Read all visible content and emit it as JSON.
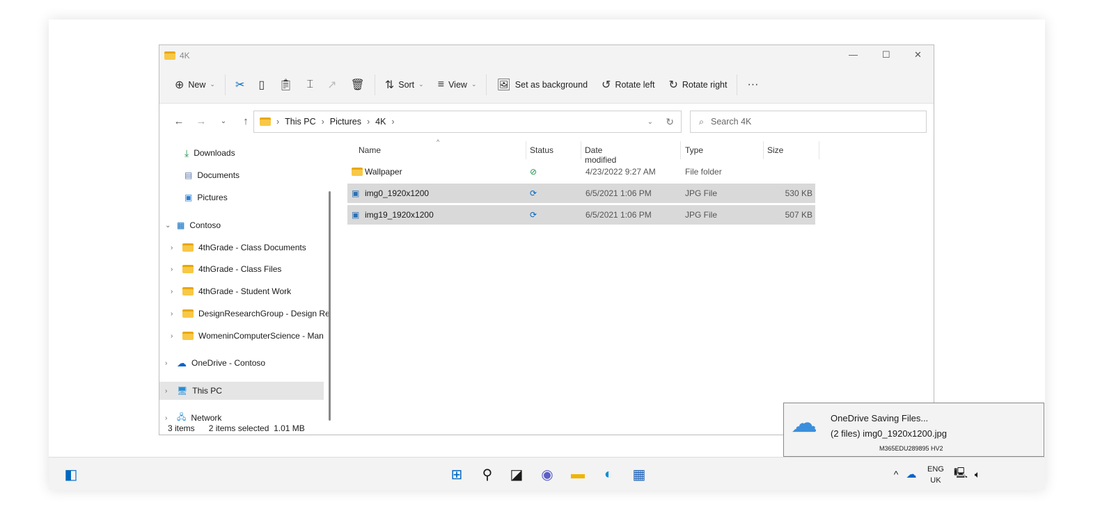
{
  "window": {
    "title": "4K"
  },
  "toolbar": {
    "new": "New",
    "sort": "Sort",
    "view": "View",
    "set_bg": "Set as background",
    "rotate_left": "Rotate left",
    "rotate_right": "Rotate right"
  },
  "address": {
    "crumbs": [
      "This PC",
      "Pictures",
      "4K"
    ]
  },
  "search": {
    "placeholder": "Search 4K"
  },
  "sidebar": {
    "items": [
      "Downloads",
      "Documents",
      "Pictures",
      "Contoso",
      "4thGrade - Class Documents",
      "4thGrade - Class Files",
      "4thGrade - Student Work",
      "DesignResearchGroup - Design Re",
      "WomeninComputerScience - Man",
      "OneDrive - Contoso",
      "This PC",
      "Network"
    ]
  },
  "columns": [
    "Name",
    "Status",
    "Date modified",
    "Type",
    "Size"
  ],
  "files": [
    {
      "name": "Wallpaper",
      "status": "synced",
      "date": "4/23/2022 9:27 AM",
      "type": "File folder",
      "size": ""
    },
    {
      "name": "img0_1920x1200",
      "status": "syncing",
      "date": "6/5/2021 1:06 PM",
      "type": "JPG File",
      "size": "530 KB"
    },
    {
      "name": "img19_1920x1200",
      "status": "syncing",
      "date": "6/5/2021 1:06 PM",
      "type": "JPG File",
      "size": "507 KB"
    }
  ],
  "statusbar": {
    "count": "3 items",
    "selected": "2 items selected  1.01 MB"
  },
  "toast": {
    "title": "OneDrive Saving Files...",
    "body": "(2 files) img0_1920x1200.jpg",
    "device": "M365EDU289895 HV2"
  },
  "tray": {
    "lang": "ENG",
    "region": "UK"
  },
  "colors": {
    "accent": "#0067c0",
    "folder": "#f8c846",
    "selection": "#d9d9d9"
  }
}
